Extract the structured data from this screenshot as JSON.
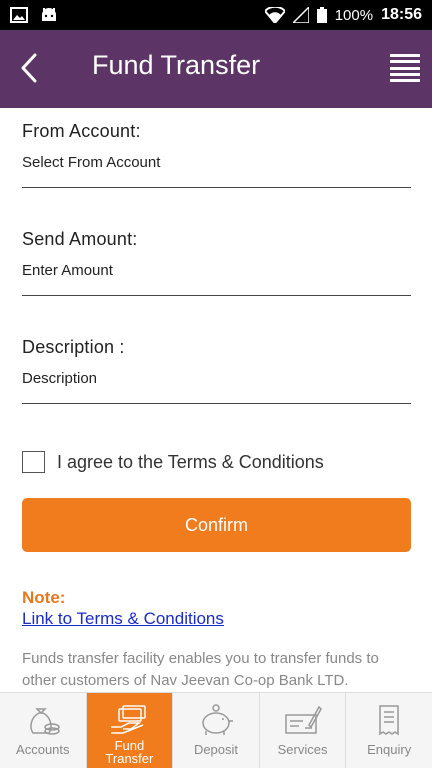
{
  "status_bar": {
    "battery": "100%",
    "time": "18:56"
  },
  "app_bar": {
    "title": "Fund Transfer"
  },
  "form": {
    "from_account": {
      "label": "From Account:",
      "placeholder": "Select From Account"
    },
    "send_amount": {
      "label": "Send Amount:",
      "placeholder": "Enter Amount"
    },
    "description": {
      "label": "Description :",
      "placeholder": "Description"
    },
    "agree_text": "I agree to the Terms & Conditions",
    "confirm_label": "Confirm"
  },
  "note": {
    "label": "Note:",
    "link_text": "Link to Terms & Conditions",
    "info": "Funds transfer facility enables you to transfer funds to other customers of Nav Jeevan Co-op Bank LTD."
  },
  "bottom_nav": {
    "items": [
      {
        "label": "Accounts",
        "icon": "money-bag-icon"
      },
      {
        "label": "Fund Transfer",
        "icon": "cash-hand-icon",
        "active": true
      },
      {
        "label": "Deposit",
        "icon": "piggy-bank-icon"
      },
      {
        "label": "Services",
        "icon": "cheque-pen-icon"
      },
      {
        "label": "Enquiry",
        "icon": "receipt-icon"
      }
    ]
  },
  "colors": {
    "app_bar": "#5c3566",
    "accent": "#f07c1e",
    "link": "#1a2bcc"
  }
}
